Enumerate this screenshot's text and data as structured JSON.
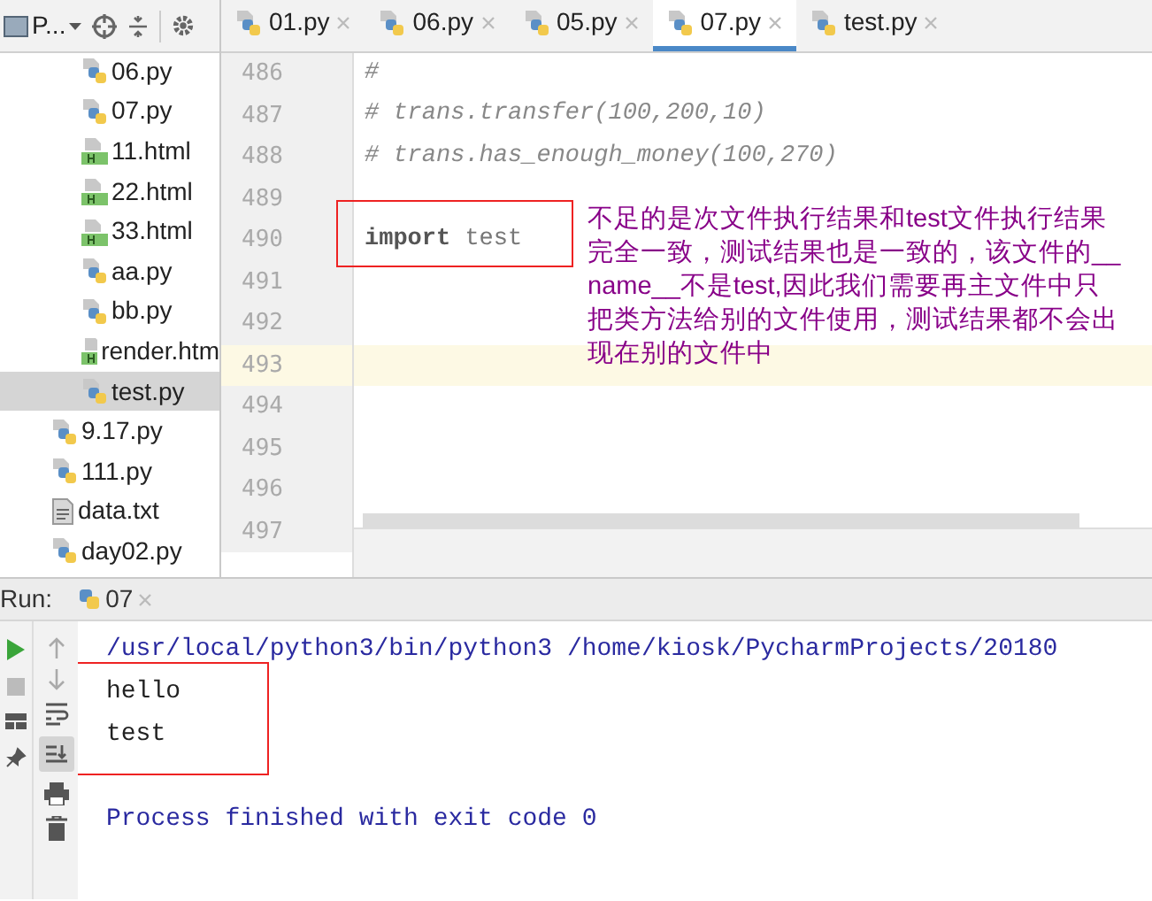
{
  "project_tool": {
    "label": "P..."
  },
  "tabs": [
    {
      "label": "01.py",
      "selected": false
    },
    {
      "label": "06.py",
      "selected": false
    },
    {
      "label": "05.py",
      "selected": false
    },
    {
      "label": "07.py",
      "selected": true
    },
    {
      "label": "test.py",
      "selected": false
    }
  ],
  "sidebar": {
    "items": [
      {
        "children": [
          {
            "label": "06.py",
            "kind": "py",
            "selected": false
          },
          {
            "label": "07.py",
            "kind": "py",
            "selected": false
          },
          {
            "label": "11.html",
            "kind": "html",
            "selected": false
          },
          {
            "label": "22.html",
            "kind": "html",
            "selected": false
          },
          {
            "label": "33.html",
            "kind": "html",
            "selected": false
          },
          {
            "label": "aa.py",
            "kind": "py",
            "selected": false
          },
          {
            "label": "bb.py",
            "kind": "py",
            "selected": false
          },
          {
            "label": "render.htm",
            "kind": "html",
            "selected": false
          },
          {
            "label": "test.py",
            "kind": "py",
            "selected": true
          }
        ]
      },
      {
        "label": "9.17.py",
        "kind": "py",
        "selected": false
      },
      {
        "label": "111.py",
        "kind": "py",
        "selected": false
      },
      {
        "label": "data.txt",
        "kind": "txt",
        "selected": false
      },
      {
        "label": "day02.py",
        "kind": "py",
        "selected": false
      }
    ]
  },
  "editor": {
    "lines": [
      {
        "number": "486",
        "text": "#",
        "kind": "comment",
        "current": false
      },
      {
        "number": "487",
        "text": "# trans.transfer(100,200,10)",
        "kind": "comment",
        "current": false
      },
      {
        "number": "488",
        "text": "# trans.has_enough_money(100,270)",
        "kind": "comment",
        "current": false
      },
      {
        "number": "489",
        "kind": "blank",
        "current": false
      },
      {
        "number": "490",
        "text": "**import** test",
        "kind": "code",
        "current": false
      },
      {
        "number": "491",
        "kind": "blank",
        "current": false
      },
      {
        "number": "492",
        "kind": "blank",
        "current": false
      },
      {
        "number": "493",
        "kind": "blank",
        "current": true
      },
      {
        "number": "494",
        "kind": "blank",
        "current": false
      },
      {
        "number": "495",
        "kind": "blank",
        "current": false
      },
      {
        "number": "496",
        "kind": "blank",
        "current": false
      },
      {
        "number": "497",
        "kind": "blank",
        "current": false
      }
    ],
    "annotation": "不足的是次文件执行结果和test文件执行结果完全一致，测试结果也是一致的，该文件的__name__不是test,因此我们需要再主文件中只把类方法给别的文件使用，测试结果都不会出现在别的文件中"
  },
  "run_panel": {
    "label": "Run:",
    "tab": "07",
    "console": [
      {
        "text": "/usr/local/python3/bin/python3 /home/kiosk/PycharmProjects/20180",
        "kind": "system"
      },
      {
        "text": "hello",
        "kind": "output"
      },
      {
        "text": "test",
        "kind": "output"
      },
      {
        "kind": "blank"
      },
      {
        "text": "Process finished with exit code 0",
        "kind": "system"
      }
    ]
  }
}
